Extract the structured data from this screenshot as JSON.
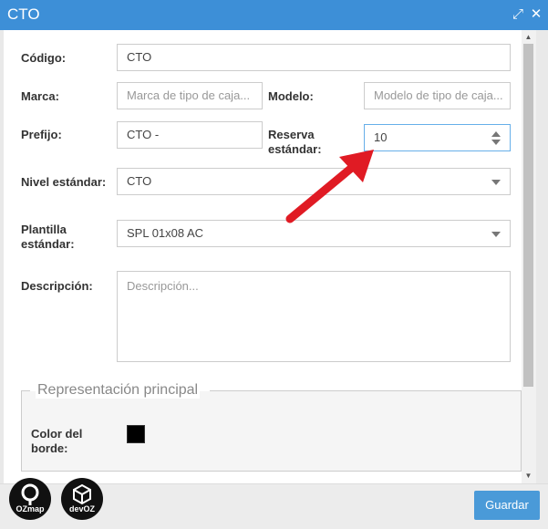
{
  "window": {
    "title": "CTO",
    "icons": [
      "expand-icon",
      "close-icon"
    ]
  },
  "form": {
    "codigo": {
      "label": "Código:",
      "value": "CTO"
    },
    "marca": {
      "label": "Marca:",
      "placeholder": "Marca de tipo de caja..."
    },
    "modelo": {
      "label": "Modelo:",
      "placeholder": "Modelo de tipo de caja..."
    },
    "prefijo": {
      "label": "Prefijo:",
      "value": "CTO -"
    },
    "reserva": {
      "label_line1": "Reserva",
      "label_line2": "estándar:",
      "value": "10"
    },
    "nivel": {
      "label": "Nivel estándar:",
      "value": "CTO"
    },
    "plantilla": {
      "label_line1": "Plantilla",
      "label_line2": "estándar:",
      "value": "SPL 01x08 AC"
    },
    "descripcion": {
      "label": "Descripción:",
      "placeholder": "Descripción..."
    }
  },
  "representacion": {
    "legend": "Representación principal",
    "color_label_line1": "Color del",
    "color_label_line2": "borde:",
    "color": "#000000"
  },
  "footer": {
    "save_label": "Guardar",
    "logo1_text": "OZmap",
    "logo2_text": "devOZ"
  },
  "colors": {
    "titlebar": "#3d8fd7",
    "save_button": "#4a9ad8",
    "annotation_arrow": "#e01b24"
  }
}
